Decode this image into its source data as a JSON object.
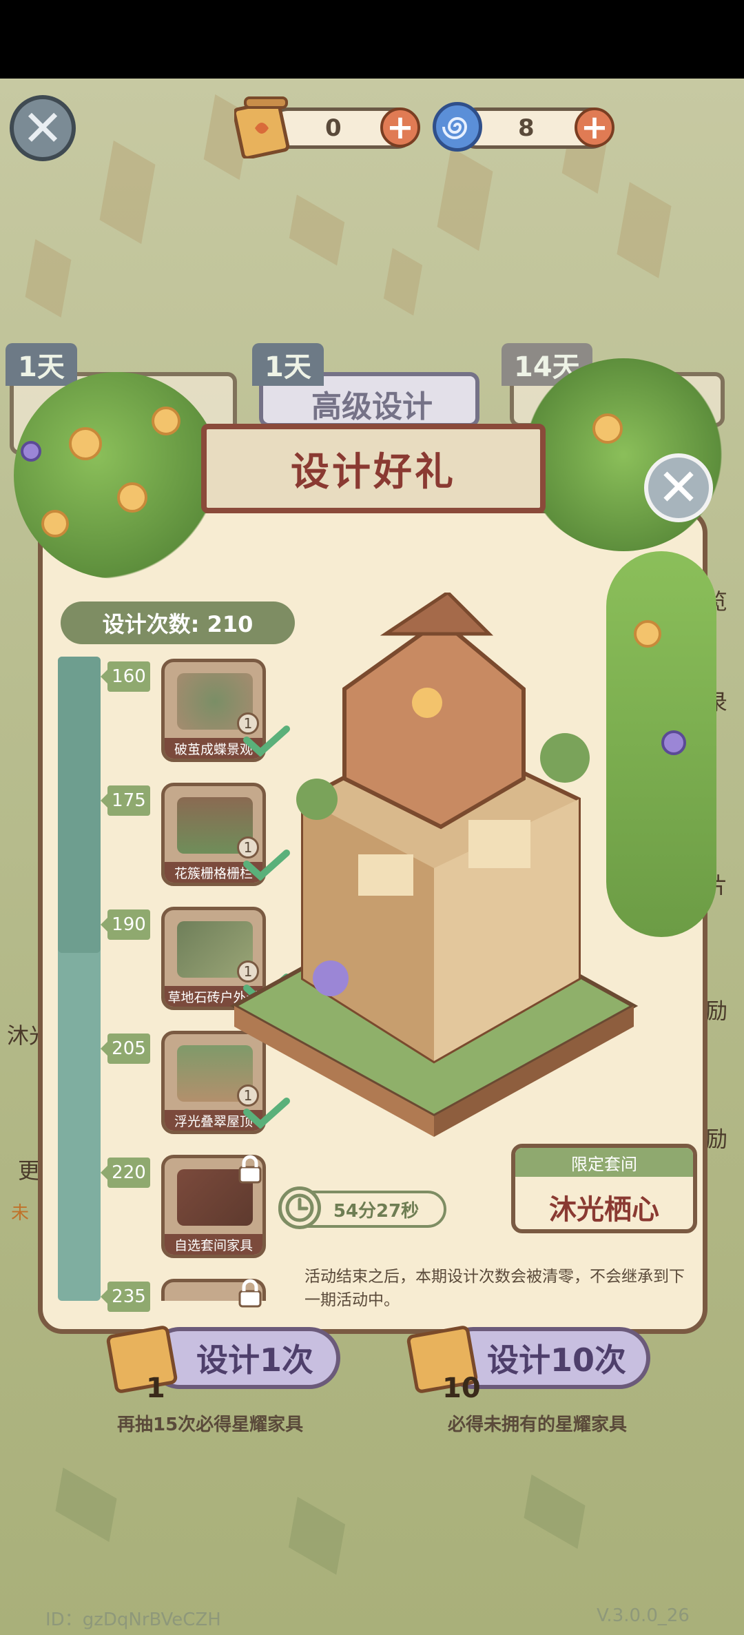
{
  "resources": {
    "tickets": "0",
    "spirals": "8"
  },
  "background": {
    "tabs": [
      {
        "day": "1天",
        "label": ""
      },
      {
        "day": "1天",
        "label": "高级设计"
      },
      {
        "day": "14天",
        "label": ""
      }
    ],
    "side_left": [
      "沐光",
      "更",
      "未"
    ],
    "side_right": [
      "览",
      "录",
      "片",
      "励",
      "励"
    ]
  },
  "panel": {
    "title": "设计好礼",
    "design_count_label": "设计次数: 210",
    "progress_fraction": 0.46,
    "milestones": [
      {
        "value": "160",
        "item": "破茧成蝶景观",
        "qty": "1",
        "state": "claimed"
      },
      {
        "value": "175",
        "item": "花簇栅格栅栏",
        "qty": "1",
        "state": "claimed"
      },
      {
        "value": "190",
        "item": "草地石砖户外道",
        "qty": "1",
        "state": "claimed"
      },
      {
        "value": "205",
        "item": "浮光叠翠屋顶",
        "qty": "1",
        "state": "claimed"
      },
      {
        "value": "220",
        "item": "自选套间家具",
        "qty": "",
        "state": "locked"
      },
      {
        "value": "235",
        "item": "",
        "qty": "",
        "state": "locked"
      }
    ],
    "timer": "54分27秒",
    "suite_tag": "限定套间",
    "suite_name": "沐光栖心",
    "notice": "活动结束之后，本期设计次数会被清零，不会继承到下一期活动中。"
  },
  "actions": {
    "draw_one": {
      "label": "设计1次",
      "cost": "1",
      "hint": "再抽15次必得星耀家具"
    },
    "draw_ten": {
      "label": "设计10次",
      "cost": "10",
      "hint": "必得未拥有的星耀家具"
    }
  },
  "footer": {
    "id": "ID：gzDqNrBVeCZH",
    "version": "V.3.0.0_26"
  },
  "colors": {
    "panel_bg": "#f7ecd2",
    "panel_border": "#7a5a42",
    "accent_green": "#7e8d63",
    "title_red": "#8a3a32",
    "button_purple": "#c8bfe0"
  },
  "icons": [
    "close-icon",
    "ticket-icon",
    "spiral-icon",
    "plus-icon",
    "check-icon",
    "lock-icon",
    "clock-icon"
  ]
}
